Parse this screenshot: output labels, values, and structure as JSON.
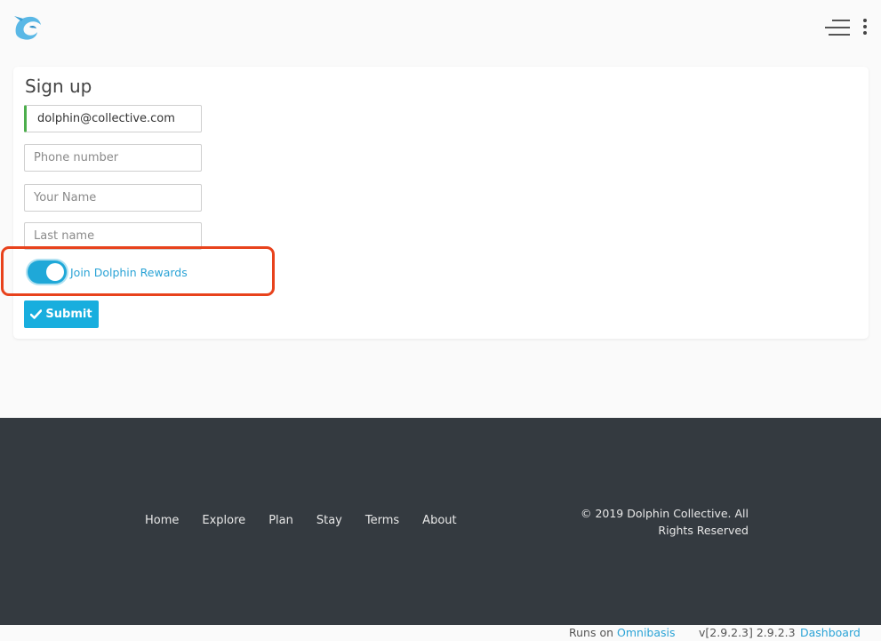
{
  "header": {
    "logo_icon": "dolphin-logo-icon",
    "menu_icon": "hamburger-menu-icon",
    "more_icon": "vertical-dots-icon"
  },
  "form": {
    "title": "Sign up",
    "email_value": "dolphin@collective.com",
    "phone_placeholder": "Phone number",
    "name_placeholder": "Your Name",
    "lastname_placeholder": "Last name",
    "rewards_label": "Join Dolphin Rewards",
    "rewards_enabled": true,
    "submit_label": "Submit",
    "submit_icon": "check-icon"
  },
  "footer": {
    "links": [
      "Home",
      "Explore",
      "Plan",
      "Stay",
      "Terms",
      "About"
    ],
    "copyright_line1": "© 2019 Dolphin Collective. All",
    "copyright_line2": "Rights Reserved"
  },
  "bottom": {
    "runs_on": "Runs on",
    "runs_link": "Omnibasis",
    "version": "v[2.9.2.3] 2.9.2.3",
    "dashboard": "Dashboard"
  },
  "colors": {
    "accent": "#18aede",
    "footer_bg": "#343a40",
    "highlight": "#e8421c",
    "valid": "#4cae4c"
  }
}
